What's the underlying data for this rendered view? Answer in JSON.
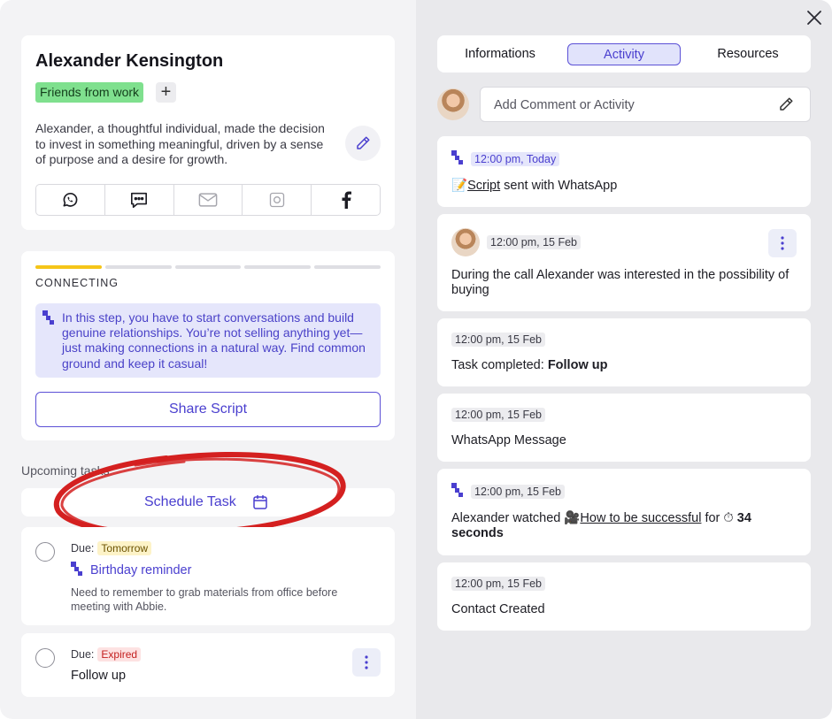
{
  "contact": {
    "name": "Alexander Kensington",
    "tag": "Friends from work",
    "tag_add": "+",
    "description": "Alexander, a thoughtful individual, made the decision to invest in something meaningful, driven by a sense of purpose and a desire for growth.",
    "channels": [
      "whatsapp-icon",
      "message-icon",
      "mail-icon",
      "instagram-icon",
      "facebook-icon"
    ]
  },
  "step": {
    "progress_steps": 5,
    "active_step": 1,
    "label": "CONNECTING",
    "info": "In this step, you have to start conversations and build genuine relationships. You’re not selling anything yet—just making connections in a natural way. Find common ground and keep it casual!",
    "share_label": "Share Script"
  },
  "tasks": {
    "heading": "Upcoming tasks",
    "schedule_label": "Schedule Task",
    "items": [
      {
        "due_label": "Due:",
        "due_value": "Tomorrow",
        "title": "Birthday reminder",
        "note": "Need to remember to grab materials from office before meeting with Abbie."
      },
      {
        "due_label": "Due:",
        "due_value": "Expired",
        "title": "Follow up"
      }
    ]
  },
  "tabs": [
    "Informations",
    "Activity",
    "Resources"
  ],
  "active_tab": "Activity",
  "comment": {
    "placeholder": "Add Comment or Activity"
  },
  "activity": [
    {
      "time": "12:00 pm, Today",
      "emoji": "📝",
      "link": "Script",
      "rest": " sent with WhatsApp"
    },
    {
      "time": "12:00 pm, 15 Feb",
      "text": "During the call Alexander was interested in the possibility of buying"
    },
    {
      "time": "12:00 pm, 15 Feb",
      "prefix": "Task completed: ",
      "bold": "Follow up"
    },
    {
      "time": "12:00 pm, 15 Feb",
      "text": "WhatsApp Message"
    },
    {
      "time": "12:00 pm, 15 Feb",
      "prefix": "Alexander watched ",
      "emoji": "🎥",
      "link": "How to be successful",
      "mid": " for ",
      "emoji2": "⏱",
      "bold": "34 seconds"
    },
    {
      "time": "12:00 pm, 15 Feb",
      "text": "Contact Created"
    }
  ],
  "colors": {
    "accent": "#4a3fcf",
    "tag": "#7fe08e",
    "progress": "#f5c518",
    "annotation": "#d42020"
  }
}
